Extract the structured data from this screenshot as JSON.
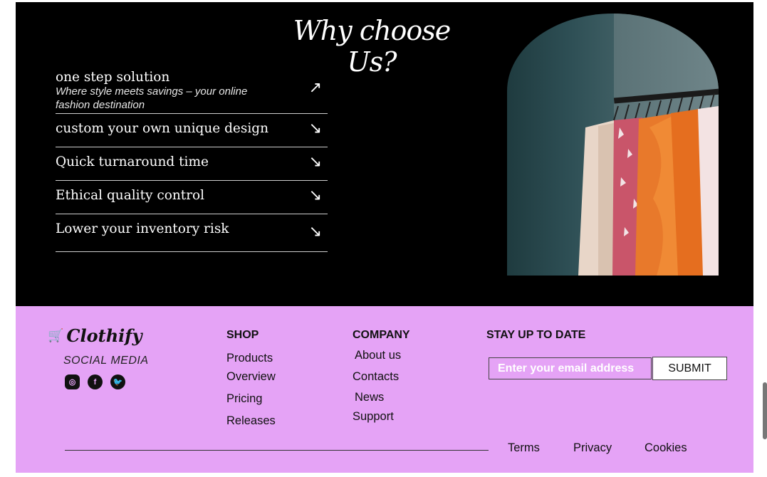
{
  "hero": {
    "title": "Why choose Us?",
    "features": [
      {
        "name": "one step solution",
        "desc": "Where style meets savings – your online fashion destination",
        "arrow": "↗"
      },
      {
        "name": "custom your own unique design",
        "arrow": "↘"
      },
      {
        "name": "Quick turnaround time",
        "arrow": "↘"
      },
      {
        "name": "Ethical quality control",
        "arrow": "↘"
      },
      {
        "name": "Lower your inventory risk",
        "arrow": "↘"
      }
    ],
    "image_icon": "clothing-rack-photo"
  },
  "footer": {
    "brand": "Clothify",
    "brand_icon": "cart-icon",
    "social_label": "SOCIAL MEDIA",
    "social_icons": [
      "instagram-icon",
      "facebook-icon",
      "twitter-icon"
    ],
    "shop": {
      "heading": "SHOP",
      "links": [
        "Products",
        "Overview",
        "Pricing",
        "Releases"
      ]
    },
    "company": {
      "heading": "COMPANY",
      "links": [
        "About us",
        "Contacts",
        "News",
        "Support"
      ]
    },
    "newsletter": {
      "heading": "STAY UP TO DATE",
      "placeholder": "Enter your email address",
      "button": "SUBMIT"
    },
    "legal": [
      "Terms",
      "Privacy",
      "Cookies"
    ]
  },
  "colors": {
    "footer_bg": "#e5a3f6",
    "hero_bg": "#000000"
  }
}
